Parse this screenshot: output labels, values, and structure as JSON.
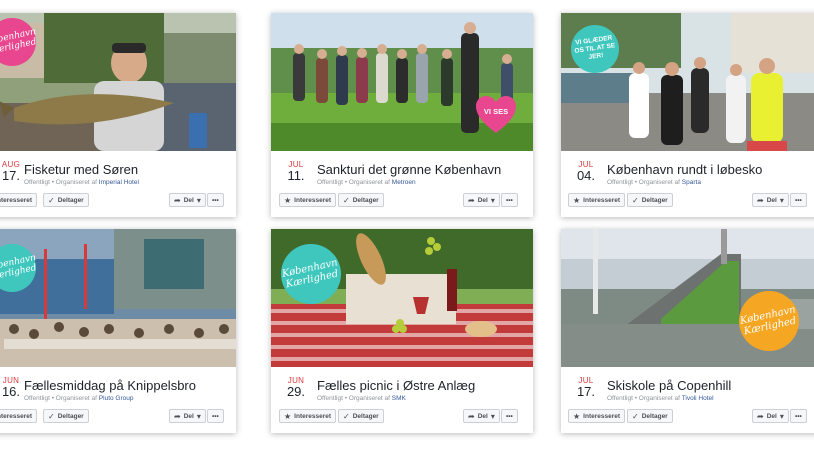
{
  "events": [
    {
      "month": "AUG",
      "day": "17.",
      "title": "Fisketur med Søren",
      "meta_prefix": "Offentligt • Organiseret af",
      "organizer": "Imperial Hotel",
      "sticker_text": "København Kærlighed",
      "badge_text": ""
    },
    {
      "month": "JUL",
      "day": "11.",
      "title": "Sankturi det grønne København",
      "meta_prefix": "Offentligt • Organiseret af",
      "organizer": "Metroen",
      "sticker_text": "",
      "badge_text": "VI SES"
    },
    {
      "month": "JUL",
      "day": "04.",
      "title": "København rundt i løbesko",
      "meta_prefix": "Offentligt • Organiseret af",
      "organizer": "Sparta",
      "sticker_text": "VI GLÆDER OS TIL AT SE JER!",
      "badge_text": ""
    },
    {
      "month": "JUN",
      "day": "16.",
      "title": "Fællesmiddag på Knippelsbro",
      "meta_prefix": "Offentligt • Organiseret af",
      "organizer": "Pluto Group",
      "sticker_text": "København Kærlighed",
      "badge_text": ""
    },
    {
      "month": "JUN",
      "day": "29.",
      "title": "Fælles picnic i Østre Anlæg",
      "meta_prefix": "Offentligt • Organiseret af",
      "organizer": "SMK",
      "sticker_text": "København Kærlighed",
      "badge_text": ""
    },
    {
      "month": "JUL",
      "day": "17.",
      "title": "Skiskole på Copenhill",
      "meta_prefix": "Offentligt • Organiseret af",
      "organizer": "Tivoli Hotel",
      "sticker_text": "København Kærlighed",
      "badge_text": ""
    }
  ],
  "buttons": {
    "interested": "Interesseret",
    "going": "Deltager",
    "share": "Del",
    "more": "•••"
  },
  "icons": {
    "interested": "star-icon",
    "going": "checkmark-icon",
    "share": "share-arrow-icon",
    "caret": "caret-down-icon"
  },
  "colors": {
    "date_month": "#e0393e",
    "link": "#365899",
    "meta": "#90949c",
    "sticker_pink": "#e8468f",
    "sticker_teal": "#3fc7bd",
    "sticker_orange": "#f5a623"
  }
}
